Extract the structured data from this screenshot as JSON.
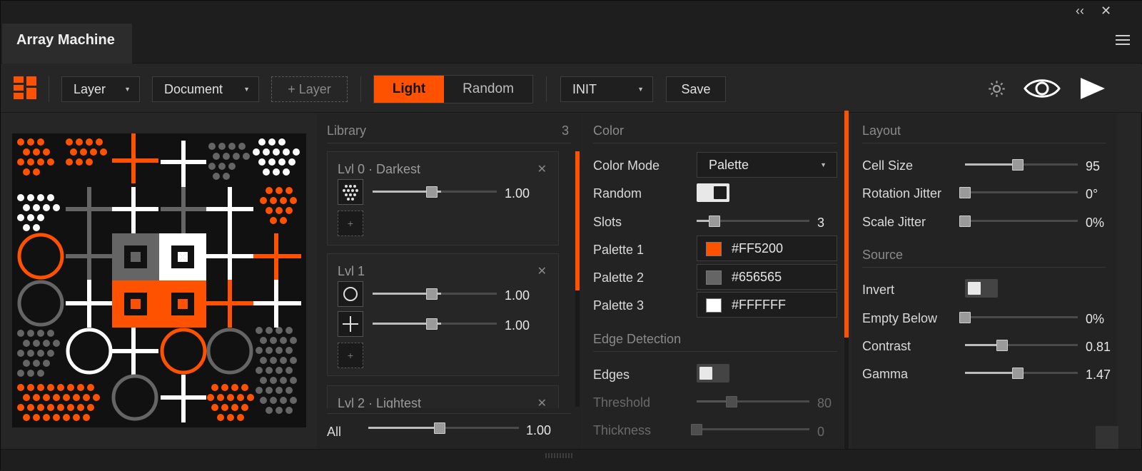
{
  "window": {
    "collapse_icon": "‹‹",
    "close_icon": "✕"
  },
  "tab": {
    "title": "Array Machine"
  },
  "toolbar": {
    "layer_dropdown": "Layer",
    "document_dropdown": "Document",
    "add_layer": "+ Layer",
    "mode_light": "Light",
    "mode_random": "Random",
    "preset_dropdown": "INIT",
    "save": "Save",
    "icons": [
      "logo-icon",
      "gear-icon",
      "eye-icon",
      "play-icon"
    ]
  },
  "library": {
    "title": "Library",
    "count": "3",
    "levels": [
      {
        "title": "Lvl 0 · Darkest",
        "items": [
          {
            "icon": "dots-pattern-icon",
            "value": "1.00",
            "level": 0.55
          }
        ]
      },
      {
        "title": "Lvl 1",
        "items": [
          {
            "icon": "circle-icon",
            "value": "1.00",
            "level": 0.55
          },
          {
            "icon": "plus-icon",
            "value": "1.00",
            "level": 0.55
          }
        ]
      },
      {
        "title": "Lvl 2 · Lightest"
      }
    ],
    "all_label": "All",
    "all_value": "1.00",
    "all_level": 0.5
  },
  "color": {
    "title": "Color",
    "color_mode_label": "Color Mode",
    "color_mode_value": "Palette",
    "random_label": "Random",
    "slots_label": "Slots",
    "slots_value": "3",
    "slots_level": 0.15,
    "palette": [
      {
        "label": "Palette 1",
        "hex": "#FF5200"
      },
      {
        "label": "Palette 2",
        "hex": "#656565"
      },
      {
        "label": "Palette 3",
        "hex": "#FFFFFF"
      }
    ],
    "edge_title": "Edge Detection",
    "edges_label": "Edges",
    "threshold_label": "Threshold",
    "threshold_value": "80",
    "threshold_level": 0.3,
    "thickness_label": "Thickness",
    "thickness_value": "0",
    "thickness_level": 0.0
  },
  "layout": {
    "title": "Layout",
    "cell_size_label": "Cell Size",
    "cell_size_value": "95",
    "cell_size_level": 0.47,
    "rotation_label": "Rotation Jitter",
    "rotation_value": "0°",
    "rotation_level": 0.0,
    "scale_label": "Scale Jitter",
    "scale_value": "0%",
    "scale_level": 0.0,
    "source_title": "Source",
    "invert_label": "Invert",
    "empty_below_label": "Empty Below",
    "empty_below_value": "0%",
    "empty_below_level": 0.0,
    "contrast_label": "Contrast",
    "contrast_value": "0.81",
    "contrast_level": 0.33,
    "gamma_label": "Gamma",
    "gamma_value": "1.47",
    "gamma_level": 0.47
  },
  "colors": {
    "accent": "#FF5200",
    "gray": "#656565",
    "white": "#FFFFFF"
  }
}
